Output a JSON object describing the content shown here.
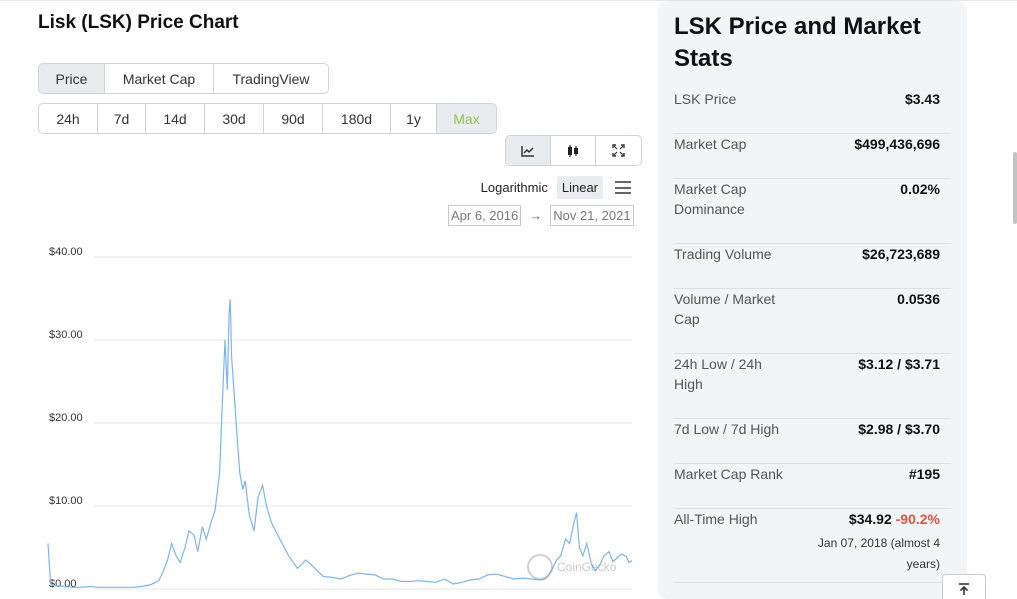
{
  "chart": {
    "title": "Lisk (LSK) Price Chart",
    "type_tabs": [
      {
        "label": "Price",
        "active": true
      },
      {
        "label": "Market Cap",
        "active": false
      },
      {
        "label": "TradingView",
        "active": false
      }
    ],
    "range_tabs": [
      {
        "label": "24h",
        "active": false
      },
      {
        "label": "7d",
        "active": false
      },
      {
        "label": "14d",
        "active": false
      },
      {
        "label": "30d",
        "active": false
      },
      {
        "label": "90d",
        "active": false
      },
      {
        "label": "180d",
        "active": false
      },
      {
        "label": "1y",
        "active": false
      },
      {
        "label": "Max",
        "active": true
      }
    ],
    "view_icons": [
      "line-chart-icon",
      "candlestick-icon",
      "expand-icon"
    ],
    "scale": {
      "log_label": "Logarithmic",
      "linear_label": "Linear",
      "active": "Linear"
    },
    "date_from": "Apr 6, 2016",
    "date_arrow": "→",
    "date_to": "Nov 21, 2021",
    "watermark": "CoinGecko",
    "line_color": "#7cb5ec"
  },
  "chart_data": {
    "type": "line",
    "title": "",
    "xlabel": "",
    "ylabel": "",
    "ylim": [
      0,
      40
    ],
    "y_ticks": [
      "$0.00",
      "$10.00",
      "$20.00",
      "$30.00",
      "$40.00"
    ],
    "x_range": [
      "Apr 6, 2016",
      "Nov 21, 2021"
    ],
    "grid": true,
    "series": [
      {
        "name": "",
        "x": [
          "2016-04-06",
          "2016-04-15",
          "2016-05-01",
          "2016-06-01",
          "2016-07-01",
          "2016-08-01",
          "2016-09-01",
          "2016-10-01",
          "2016-11-01",
          "2016-12-01",
          "2017-01-01",
          "2017-02-01",
          "2017-03-01",
          "2017-04-01",
          "2017-05-01",
          "2017-05-15",
          "2017-06-01",
          "2017-06-15",
          "2017-07-01",
          "2017-07-15",
          "2017-08-01",
          "2017-08-15",
          "2017-09-01",
          "2017-09-15",
          "2017-10-01",
          "2017-10-15",
          "2017-11-01",
          "2017-11-15",
          "2017-12-01",
          "2017-12-10",
          "2017-12-20",
          "2017-12-28",
          "2018-01-03",
          "2018-01-07",
          "2018-01-12",
          "2018-01-20",
          "2018-02-01",
          "2018-02-10",
          "2018-02-20",
          "2018-03-01",
          "2018-03-15",
          "2018-04-01",
          "2018-04-15",
          "2018-05-01",
          "2018-05-15",
          "2018-06-01",
          "2018-07-01",
          "2018-08-01",
          "2018-09-01",
          "2018-10-01",
          "2018-11-01",
          "2018-12-01",
          "2019-01-01",
          "2019-02-01",
          "2019-03-01",
          "2019-04-01",
          "2019-05-01",
          "2019-06-01",
          "2019-07-01",
          "2019-08-01",
          "2019-09-01",
          "2019-10-01",
          "2019-11-01",
          "2019-12-01",
          "2020-01-01",
          "2020-02-01",
          "2020-03-01",
          "2020-04-01",
          "2020-05-01",
          "2020-06-01",
          "2020-07-01",
          "2020-08-01",
          "2020-09-01",
          "2020-10-01",
          "2020-11-01",
          "2020-12-01",
          "2021-01-01",
          "2021-01-20",
          "2021-02-01",
          "2021-02-15",
          "2021-03-01",
          "2021-03-15",
          "2021-04-01",
          "2021-04-15",
          "2021-05-01",
          "2021-05-10",
          "2021-05-20",
          "2021-06-01",
          "2021-06-15",
          "2021-07-01",
          "2021-07-15",
          "2021-08-01",
          "2021-08-15",
          "2021-09-01",
          "2021-09-15",
          "2021-10-01",
          "2021-10-15",
          "2021-11-01",
          "2021-11-10",
          "2021-11-21"
        ],
        "y": [
          5.5,
          0.6,
          0.4,
          0.3,
          0.2,
          0.2,
          0.3,
          0.2,
          0.2,
          0.2,
          0.2,
          0.2,
          0.3,
          0.5,
          1.0,
          2.0,
          3.5,
          5.5,
          4.0,
          3.2,
          5.0,
          7.0,
          6.5,
          4.5,
          7.5,
          6.0,
          8.0,
          9.5,
          14.0,
          22.0,
          30.0,
          24.0,
          33.0,
          34.9,
          28.0,
          24.0,
          18.0,
          14.0,
          12.0,
          13.0,
          9.0,
          7.0,
          11.0,
          12.5,
          10.0,
          8.0,
          6.0,
          4.0,
          2.5,
          3.5,
          2.5,
          1.5,
          1.4,
          1.2,
          1.6,
          1.9,
          1.8,
          1.7,
          1.2,
          1.2,
          0.9,
          0.9,
          1.0,
          0.9,
          0.8,
          1.2,
          0.6,
          0.8,
          1.1,
          1.2,
          1.7,
          1.8,
          1.5,
          1.2,
          1.3,
          1.2,
          1.1,
          1.2,
          1.7,
          2.5,
          3.5,
          4.0,
          6.0,
          5.5,
          8.0,
          9.2,
          5.0,
          4.0,
          5.5,
          3.0,
          2.2,
          3.0,
          4.0,
          4.5,
          3.3,
          3.8,
          4.2,
          3.9,
          3.2,
          3.4
        ]
      }
    ]
  },
  "stats": {
    "title": "LSK Price and Market Stats",
    "rows": [
      {
        "label": "LSK Price",
        "value": "$3.43"
      },
      {
        "label": "Market Cap",
        "value": "$499,436,696"
      },
      {
        "label": "Market Cap Dominance",
        "value": "0.02%"
      },
      {
        "label": "Trading Volume",
        "value": "$26,723,689"
      },
      {
        "label": "Volume / Market Cap",
        "value": "0.0536"
      },
      {
        "label": "24h Low / 24h High",
        "value": "$3.12 / $3.71"
      },
      {
        "label": "7d Low / 7d High",
        "value": "$2.98 / $3.70"
      },
      {
        "label": "Market Cap Rank",
        "value": "#195"
      }
    ],
    "ath": {
      "label": "All-Time High",
      "value": "$34.92",
      "change": "-90.2%",
      "sub": "Jan 07, 2018 (almost 4 years)"
    }
  },
  "colors": {
    "accent_green": "#8dc647",
    "negative_red": "#e15241"
  }
}
